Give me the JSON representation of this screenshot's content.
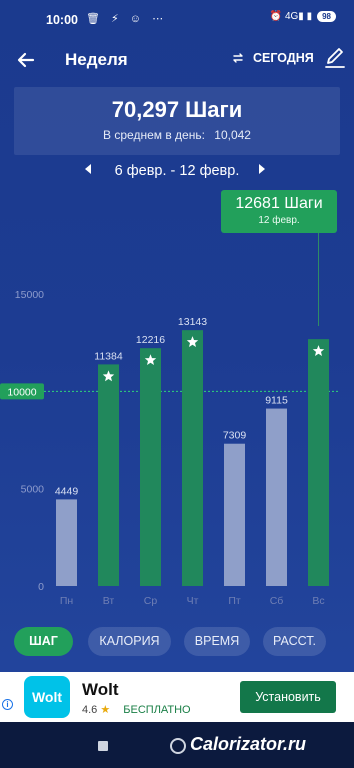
{
  "status_bar": {
    "time": "10:00",
    "icons": "🗑 ⚡ ☺ ⋯",
    "right_icons": "⏰ 4G▮ ▮",
    "battery": "98"
  },
  "header": {
    "back_icon": "arrow-left-icon",
    "title": "Неделя",
    "today_icon": "swap-icon",
    "today_label": "СЕГОДНЯ",
    "edit_icon": "pencil-icon"
  },
  "summary": {
    "total": "70,297 Шаги",
    "avg_label": "В среднем в день:",
    "avg_value": "10,042"
  },
  "date_nav": {
    "range": "6 февр. - 12 февр."
  },
  "tooltip": {
    "value": "12681 Шаги",
    "date": "12 февр."
  },
  "chart_data": {
    "type": "bar",
    "categories": [
      "Пн",
      "Вт",
      "Ср",
      "Чт",
      "Пт",
      "Сб",
      "Вс"
    ],
    "values": [
      4449,
      11384,
      12216,
      13143,
      7309,
      9115,
      12681
    ],
    "value_labels": [
      "4449",
      "11384",
      "12216",
      "13143",
      "7309",
      "9115",
      ""
    ],
    "ylim": [
      0,
      15000
    ],
    "yticks": [
      0,
      5000,
      15000
    ],
    "ytick_labels": [
      "0",
      "5000",
      "15000"
    ],
    "goal": 10000,
    "goal_label": "10000",
    "colors": {
      "above_goal": "#21885c",
      "below_goal": "#8f9fc9",
      "goal_line": "#2fd47a",
      "goal_label_bg": "#22a05b",
      "star": "#ffffff"
    }
  },
  "tabs": [
    {
      "label": "ШАГ",
      "active": true
    },
    {
      "label": "КАЛОРИЯ",
      "active": false
    },
    {
      "label": "ВРЕМЯ",
      "active": false
    },
    {
      "label": "РАССТ.",
      "active": false
    }
  ],
  "ad": {
    "logo_text": "Wolt",
    "name": "Wolt",
    "rating": "4.6",
    "star": "★",
    "price": "БЕСПЛАТНО",
    "install_label": "Установить",
    "info_icon": "info-icon"
  },
  "nav_bar": {
    "watermark": "Calorizator.ru"
  }
}
